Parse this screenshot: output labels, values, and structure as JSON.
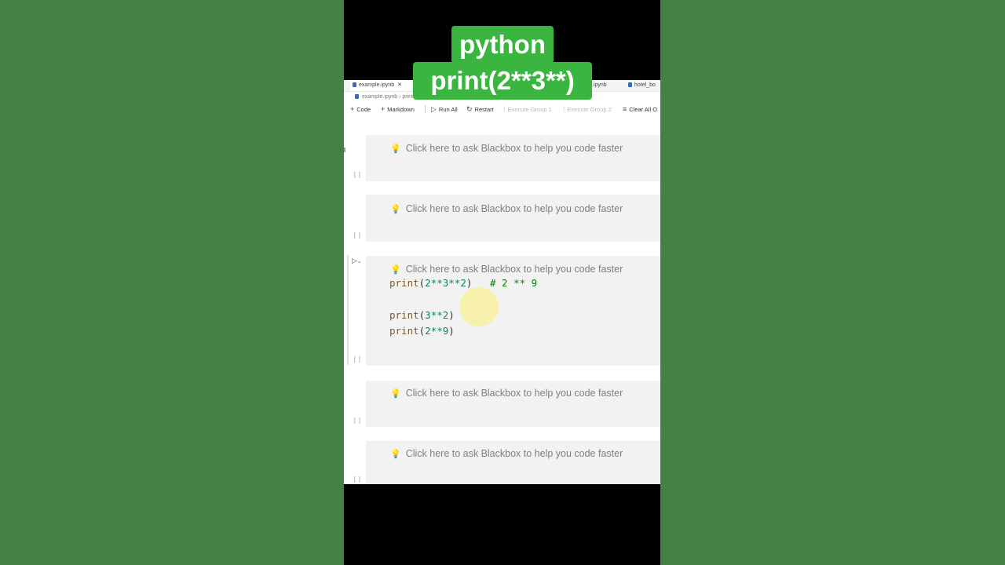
{
  "overlay": {
    "line1": "python",
    "line2": "print(2**3**)"
  },
  "tabs": [
    {
      "label": "example.ipynb",
      "close": "✕",
      "active": true
    },
    {
      "label": ".ipynb",
      "active": false
    },
    {
      "label": "hotel_bo",
      "active": false
    }
  ],
  "breadcrumb": {
    "file": "example.ipynb",
    "sep": "›",
    "cell": "print(2**3**2)  # 2 ** 9"
  },
  "toolbar": {
    "code": "Code",
    "markdown": "Markdown",
    "run_all": "Run All",
    "restart": "Restart",
    "execute_group_1": "Execute Group 1",
    "execute_group_2": "Execute Group 2",
    "clear_all": "Clear All O"
  },
  "cells": [
    {
      "hint": "Click here to ask Blackbox to help you code faster"
    },
    {
      "hint": "Click here to ask Blackbox to help you code faster"
    },
    {
      "hint": "Click here to ask Blackbox to help you code faster",
      "code": {
        "line1_fn": "print",
        "line1_open": "(",
        "line1_args": "2**3**2",
        "line1_close": ")",
        "line1_comment": "# 2 ** 9",
        "line2_fn": "print",
        "line2_open": "(",
        "line2_args": "3**2",
        "line2_close": ")",
        "line3_fn": "print",
        "line3_open": "(",
        "line3_args": "2**9",
        "line3_close": ")"
      }
    },
    {
      "hint": "Click here to ask Blackbox to help you code faster"
    },
    {
      "hint": "Click here to ask Blackbox to help you code faster"
    }
  ],
  "gutter_marker": "[ ]",
  "icons": {
    "bulb": "lightbulb-icon",
    "run": "run-cell-icon",
    "plus": "plus-icon",
    "restart": "restart-icon"
  },
  "colors": {
    "background": "#468043",
    "title_bg": "#3ab53f",
    "cell_bg": "#f2f2f2",
    "hint_text": "#7f7f7f"
  }
}
